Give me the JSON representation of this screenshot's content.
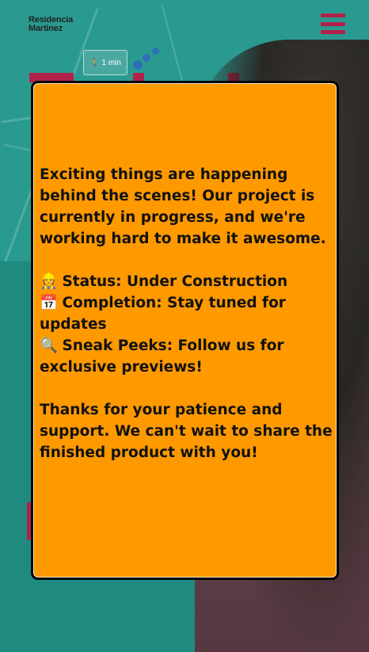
{
  "brand": {
    "line1": "Residencia",
    "line2": "Martinez",
    "accent_color": "#b0224a",
    "background_teal": "#1e8a80"
  },
  "menu": {
    "icon": "hamburger-menu-icon"
  },
  "map": {
    "walk_label": "1 min"
  },
  "modal": {
    "background_color": "#fe9900",
    "intro": "Exciting things are happening behind the scenes! Our project is currently in progress, and we're working hard to make it awesome.",
    "items": [
      {
        "emoji": "👷",
        "icon": "construction-worker-icon",
        "text": "Status: Under Construction"
      },
      {
        "emoji": "📅",
        "icon": "calendar-icon",
        "text": "Completion: Stay tuned for updates"
      },
      {
        "emoji": "🔍",
        "icon": "magnifier-icon",
        "text": "Sneak Peeks: Follow us for exclusive previews!"
      }
    ],
    "closing": "Thanks for your patience and support. We can't wait to share the finished product with you!"
  }
}
